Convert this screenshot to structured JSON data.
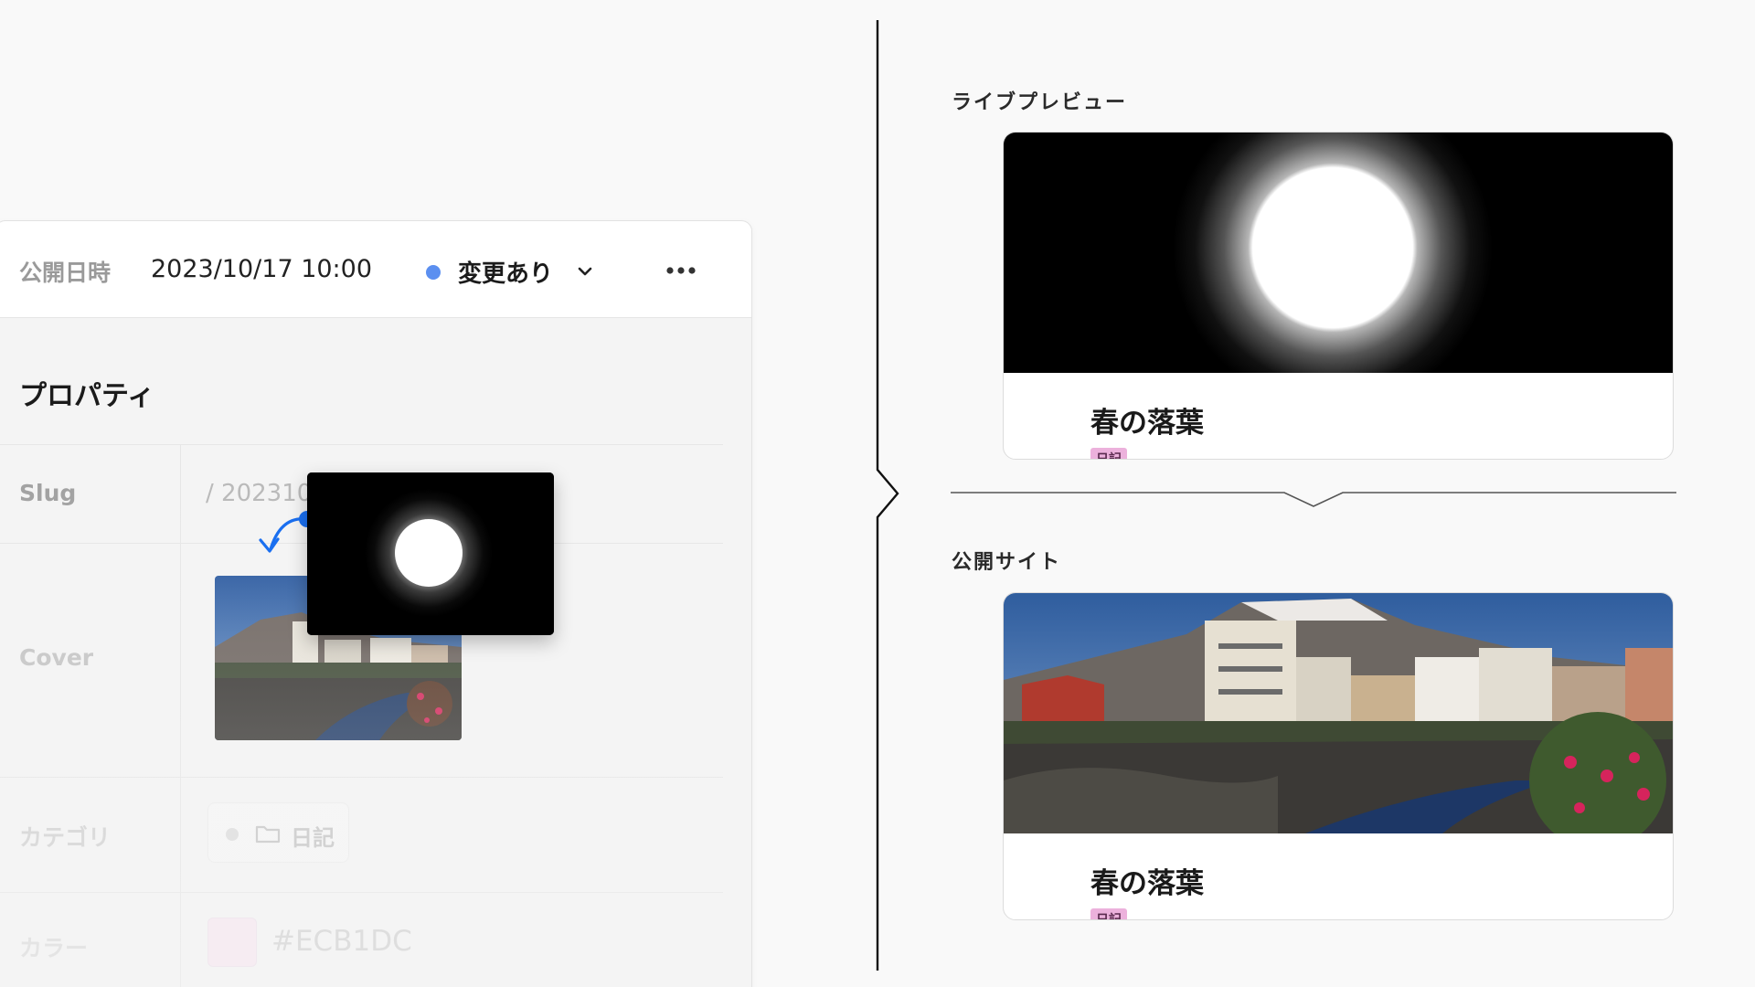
{
  "editor": {
    "toolbar": {
      "publish_label": "公開日時",
      "publish_datetime": "2023/10/17 10:00",
      "status": "変更あり",
      "status_color": "#5b8ff0"
    },
    "properties_title": "プロパティ",
    "rows": {
      "slug": {
        "label": "Slug",
        "value": "/ 202310"
      },
      "cover": {
        "label": "Cover"
      },
      "category": {
        "label": "カテゴリ",
        "value": "日記"
      },
      "color": {
        "label": "カラー",
        "value": "#ECB1DC"
      }
    }
  },
  "preview": {
    "live_label": "ライブプレビュー",
    "public_label": "公開サイト",
    "cards": [
      {
        "title": "春の落葉",
        "tag": "日記",
        "tag_color": "#ECB1DC"
      },
      {
        "title": "春の落葉",
        "tag": "日記",
        "tag_color": "#ECB1DC"
      }
    ]
  }
}
